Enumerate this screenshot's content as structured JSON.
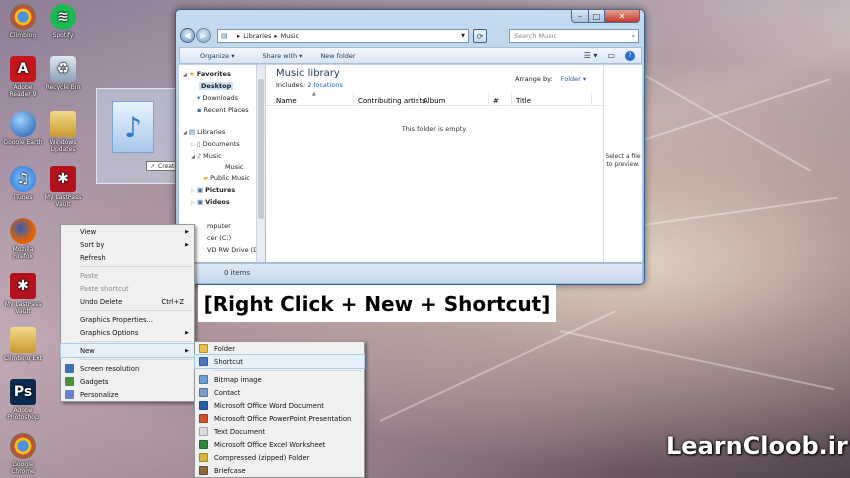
{
  "colors": {
    "window_frame": "#9dbbd8",
    "menu_bg": "#f0f0f0",
    "highlight": "#e6f0fa"
  },
  "desktop_icons": [
    {
      "label": "Climbing",
      "icon": "chrome-icon"
    },
    {
      "label": "Spotify",
      "icon": "spotify-icon"
    },
    {
      "label": "Adobe Reader 9",
      "icon": "adobe-reader-icon"
    },
    {
      "label": "Recycle Bin",
      "icon": "recycle-bin-icon"
    },
    {
      "label": "Google Earth",
      "icon": "google-earth-icon"
    },
    {
      "label": "Windows Updates",
      "icon": "folder-icon"
    },
    {
      "label": "iTunes",
      "icon": "itunes-icon"
    },
    {
      "label": "My LastPass Vault",
      "icon": "lastpass-icon"
    },
    {
      "label": "Mozilla Firefox",
      "icon": "firefox-icon"
    },
    {
      "label": "My LastPass Vault",
      "icon": "lastpass-icon"
    },
    {
      "label": "Climbing Ext",
      "icon": "folder-icon"
    },
    {
      "label": "Adobe Photoshop",
      "icon": "photoshop-icon"
    },
    {
      "label": "Google Chrome",
      "icon": "chrome-icon"
    }
  ],
  "explorer": {
    "breadcrumb": [
      "Libraries",
      "Music"
    ],
    "search_placeholder": "Search Music",
    "toolbar": {
      "organize": "Organize",
      "share": "Share with",
      "new_folder": "New folder"
    },
    "nav": {
      "favorites": "Favorites",
      "desktop": "Desktop",
      "downloads": "Downloads",
      "recent": "Recent Places",
      "libraries": "Libraries",
      "documents": "Documents",
      "music": "Music",
      "my_music": "Music",
      "public_music": "Public Music",
      "pictures": "Pictures",
      "videos": "Videos",
      "computer": "mputer",
      "drive_c": "cer (C:)",
      "dvd": "VD RW Drive (D"
    },
    "library_title": "Music library",
    "includes": "Includes:",
    "locations": "2 locations",
    "arrange_by": "Arrange by:",
    "arrange_value": "Folder",
    "columns": [
      "Name",
      "Contributing artists",
      "Album",
      "#",
      "Title"
    ],
    "empty_message": "This folder is empty.",
    "preview_text": "Select a file to preview.",
    "status": "0 items"
  },
  "drag_tooltip": "Create link in Desktop",
  "context_menu": {
    "items": [
      {
        "label": "View",
        "arrow": true
      },
      {
        "label": "Sort by",
        "arrow": true
      },
      {
        "label": "Refresh"
      },
      {
        "sep": true
      },
      {
        "label": "Paste",
        "disabled": true
      },
      {
        "label": "Paste shortcut",
        "disabled": true
      },
      {
        "label": "Undo Delete",
        "shortcut": "Ctrl+Z"
      },
      {
        "sep": true
      },
      {
        "label": "Graphics Properties..."
      },
      {
        "label": "Graphics Options",
        "arrow": true
      },
      {
        "sep": true
      },
      {
        "label": "New",
        "arrow": true,
        "highlight": true
      },
      {
        "sep": true
      },
      {
        "label": "Screen resolution"
      },
      {
        "label": "Gadgets"
      },
      {
        "label": "Personalize"
      }
    ]
  },
  "new_menu": {
    "items": [
      {
        "label": "Folder",
        "icon": "folder-icon",
        "color": "#e8c04a"
      },
      {
        "label": "Shortcut",
        "icon": "shortcut-icon",
        "color": "#4a78c0",
        "highlight": true
      },
      {
        "sep": true
      },
      {
        "label": "Bitmap image",
        "icon": "bitmap-icon",
        "color": "#6aa0d8"
      },
      {
        "label": "Contact",
        "icon": "contact-icon",
        "color": "#7a9cc6"
      },
      {
        "label": "Microsoft Office Word Document",
        "icon": "word-icon",
        "color": "#2b5cab"
      },
      {
        "label": "Microsoft Office PowerPoint Presentation",
        "icon": "powerpoint-icon",
        "color": "#d0522c"
      },
      {
        "label": "Text Document",
        "icon": "text-document-icon",
        "color": "#dddddd"
      },
      {
        "label": "Microsoft Office Excel Worksheet",
        "icon": "excel-icon",
        "color": "#2f8a3e"
      },
      {
        "label": "Compressed (zipped) Folder",
        "icon": "zip-folder-icon",
        "color": "#d9b441"
      },
      {
        "label": "Briefcase",
        "icon": "briefcase-icon",
        "color": "#8a6a3a"
      }
    ]
  },
  "caption": "[Right Click + New + Shortcut]",
  "watermark": "LearnCloob.ir"
}
